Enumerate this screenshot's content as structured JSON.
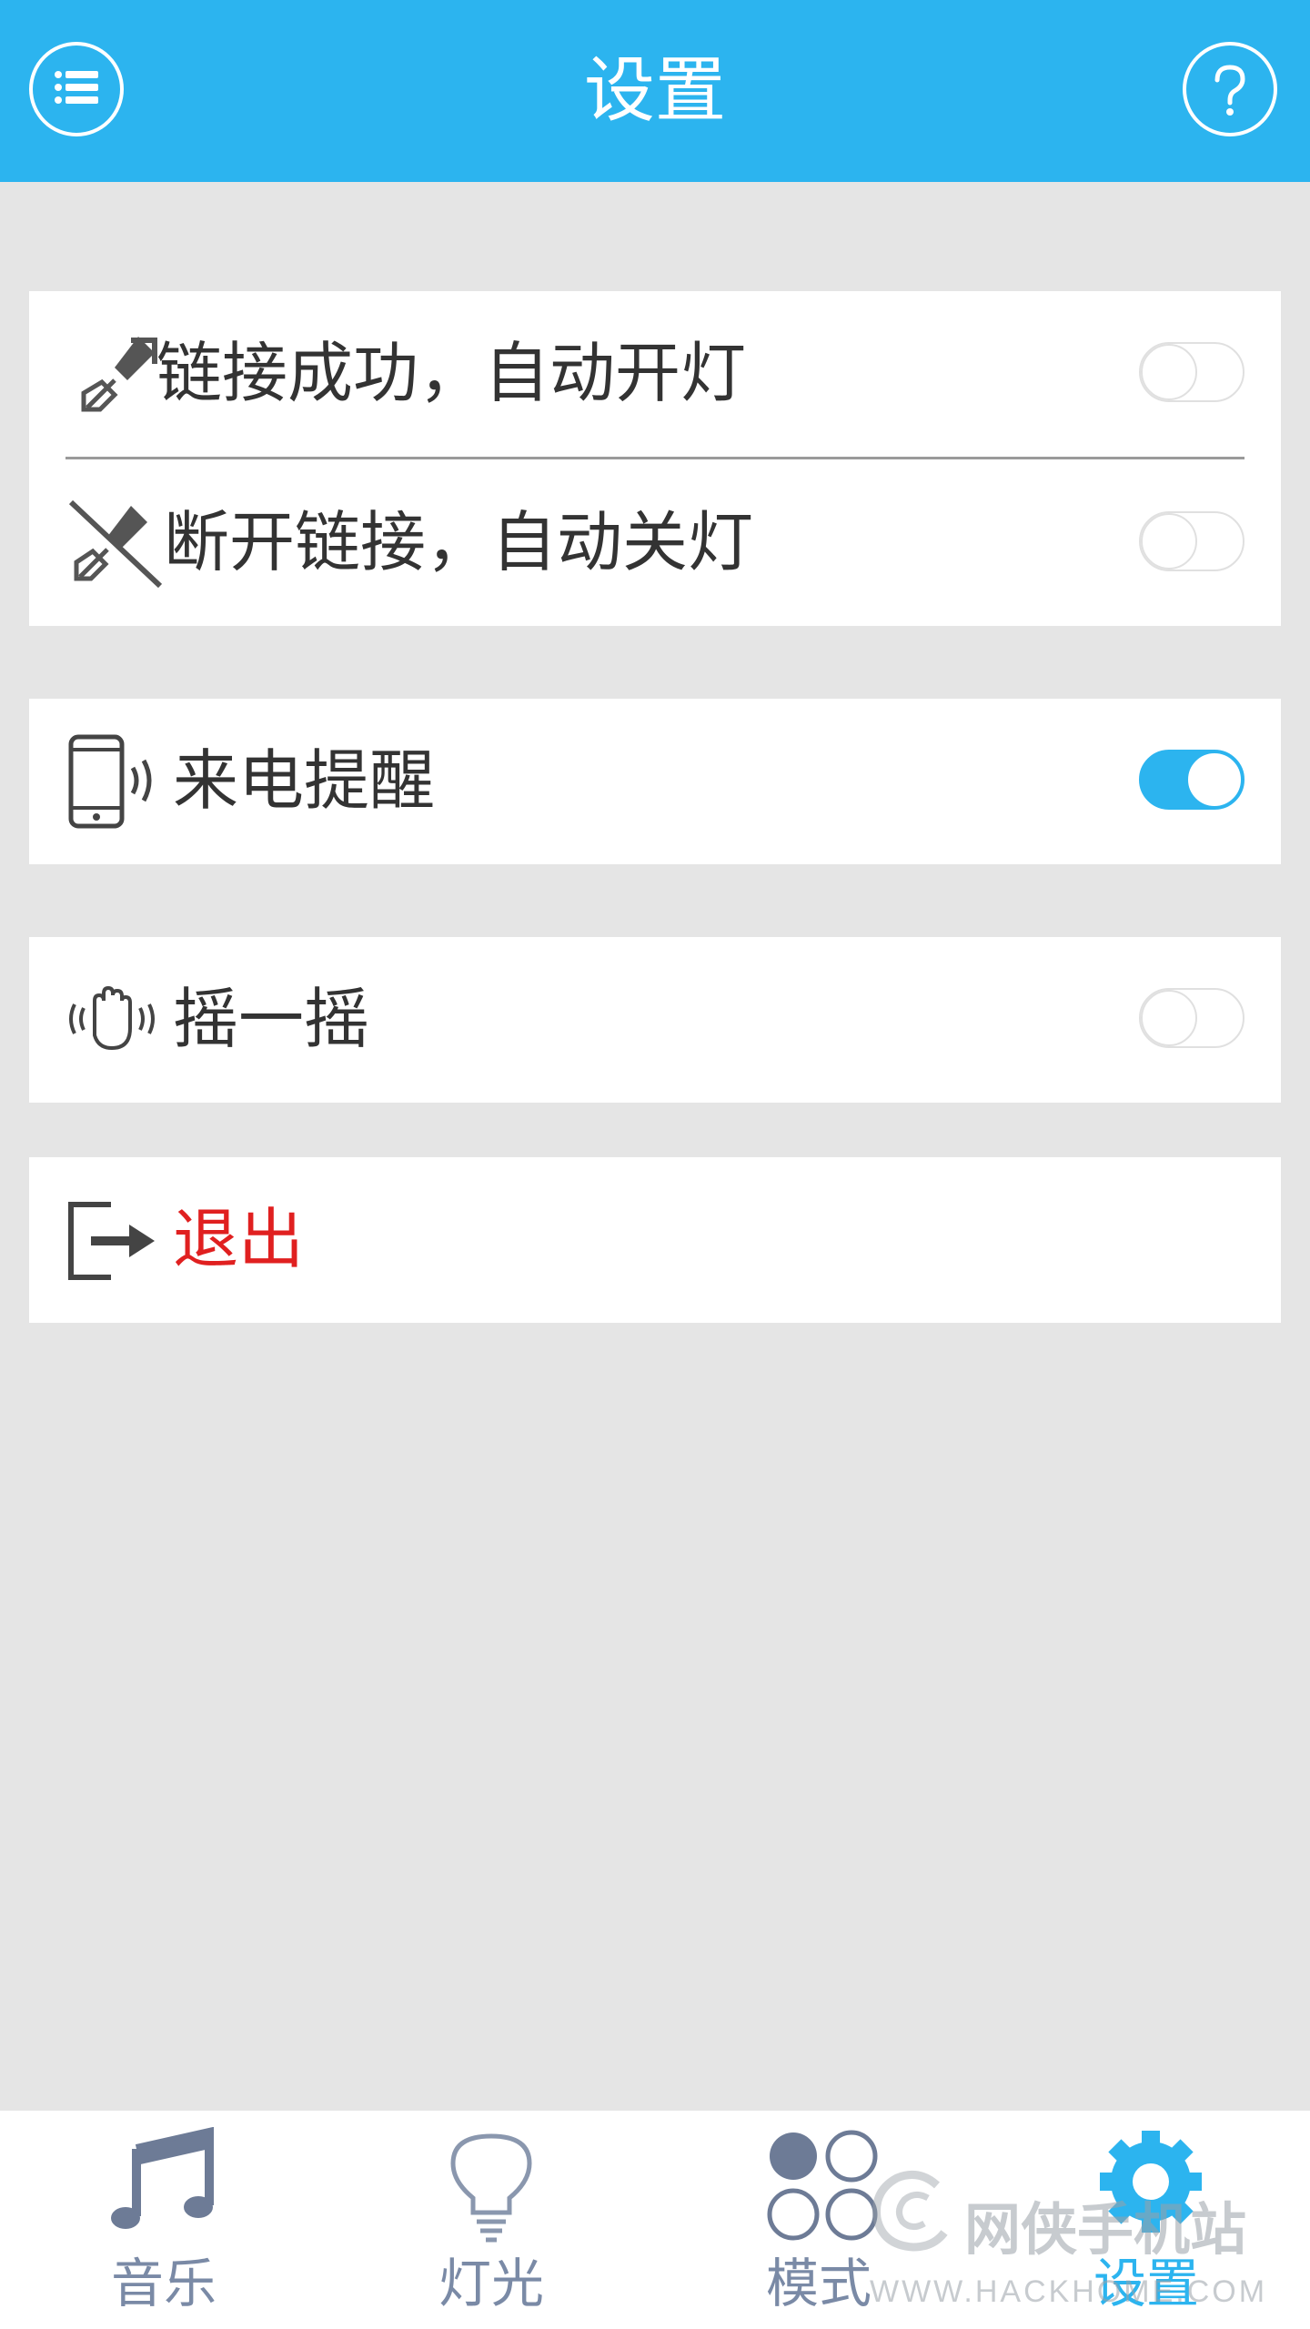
{
  "header": {
    "title": "设置",
    "left_icon": "list-icon",
    "right_icon": "help-icon",
    "color": "#2cb4ef"
  },
  "settings": {
    "connect_on": {
      "label": "链接成功，自动开灯",
      "icon": "link-icon",
      "enabled": false
    },
    "disconnect_off": {
      "label": "断开链接，自动关灯",
      "icon": "unlink-icon",
      "enabled": false
    },
    "call_reminder": {
      "label": "来电提醒",
      "icon": "phone-ring-icon",
      "enabled": true
    },
    "shake": {
      "label": "摇一摇",
      "icon": "shake-hand-icon",
      "enabled": false
    },
    "logout": {
      "label": "退出",
      "icon": "logout-icon",
      "color": "#e02020"
    }
  },
  "tabs": [
    {
      "label": "音乐",
      "icon": "music-note-icon",
      "active": false
    },
    {
      "label": "灯光",
      "icon": "light-bulb-icon",
      "active": false
    },
    {
      "label": "模式",
      "icon": "mode-circles-icon",
      "active": false
    },
    {
      "label": "设置",
      "icon": "gear-icon",
      "active": true
    }
  ],
  "watermark": {
    "name": "网侠手机站",
    "url": "WWW.HACKHOME.COM"
  }
}
